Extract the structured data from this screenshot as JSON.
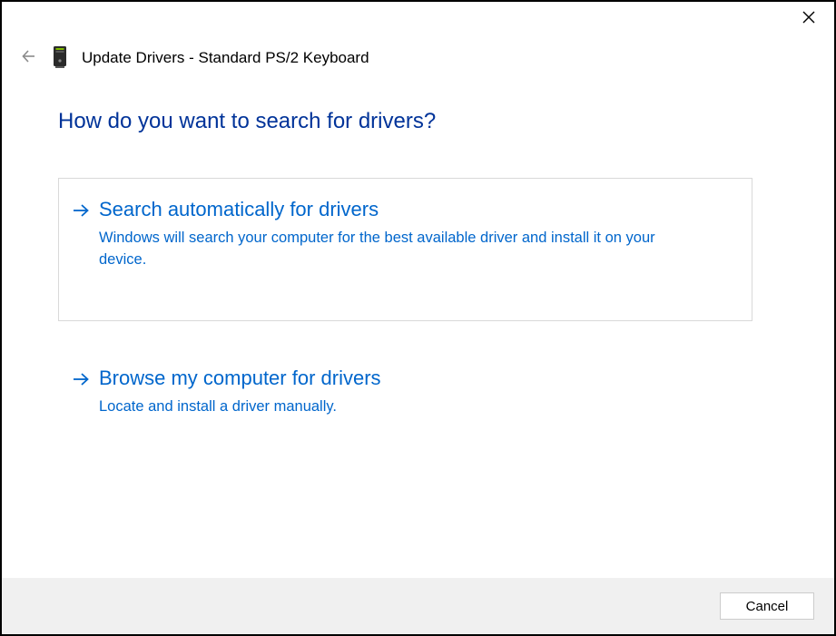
{
  "titlebar": {
    "close_icon": "close"
  },
  "header": {
    "back_icon": "back-arrow",
    "device_icon": "pc-tower-icon",
    "title": "Update Drivers - Standard PS/2 Keyboard"
  },
  "main": {
    "heading": "How do you want to search for drivers?",
    "options": [
      {
        "title": "Search automatically for drivers",
        "description": "Windows will search your computer for the best available driver and install it on your device.",
        "selected": true
      },
      {
        "title": "Browse my computer for drivers",
        "description": "Locate and install a driver manually.",
        "selected": false
      }
    ]
  },
  "footer": {
    "cancel_label": "Cancel"
  },
  "colors": {
    "link_blue": "#0066cc",
    "heading_blue": "#003399",
    "footer_bg": "#f0f0f0",
    "border_grey": "#d9d9d9"
  }
}
